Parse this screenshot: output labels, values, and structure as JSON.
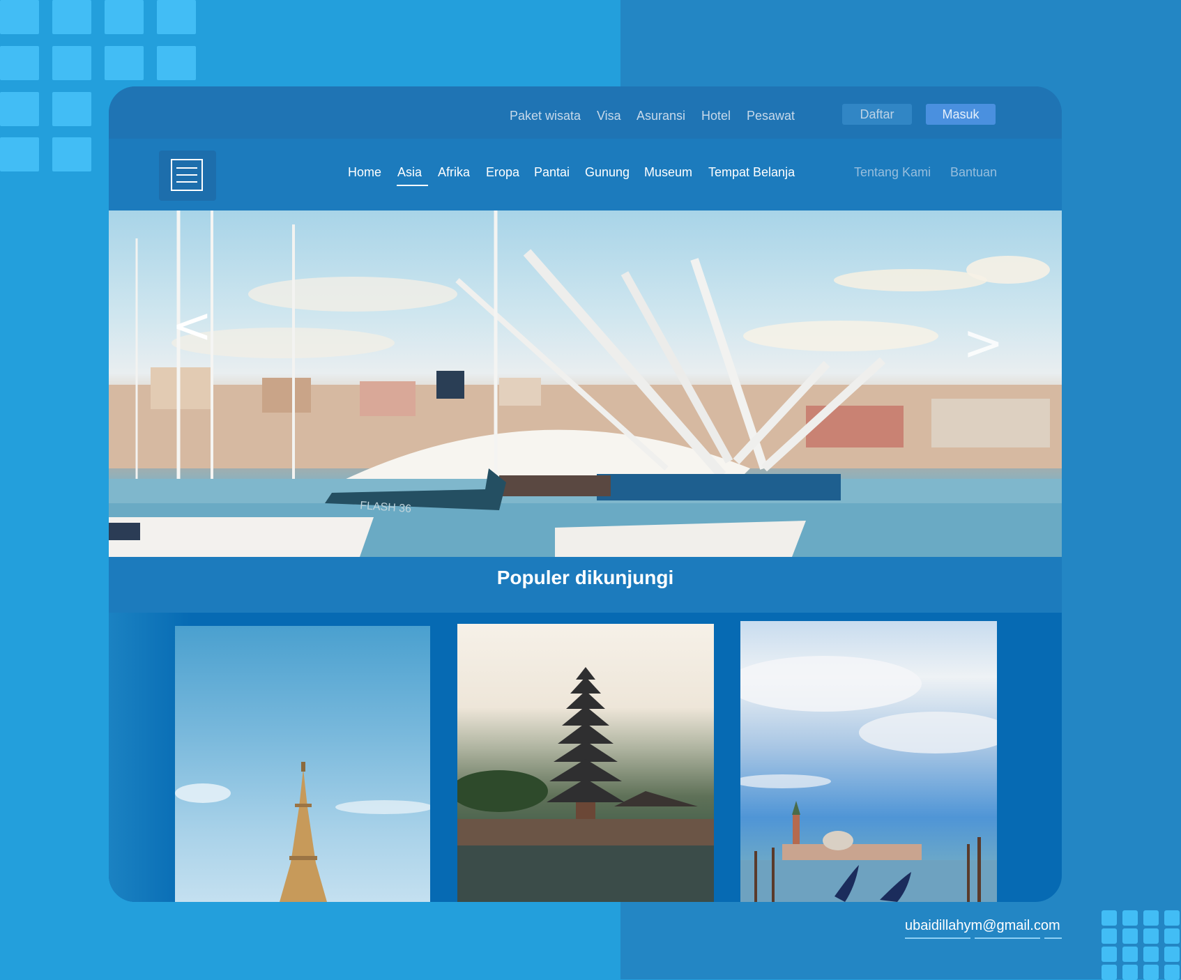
{
  "top_nav": {
    "links": [
      "Paket wisata",
      "Visa",
      "Asuransi",
      "Hotel",
      "Pesawat"
    ],
    "register_label": "Daftar",
    "login_label": "Masuk"
  },
  "main_nav": {
    "categories": [
      "Home",
      "Asia",
      "Afrika",
      "Eropa",
      "Pantai",
      "Gunung",
      "Museum",
      "Tempat Belanja"
    ],
    "active": "Asia",
    "secondary": [
      "Tentang Kami",
      "Bantuan"
    ]
  },
  "hero": {
    "prev_label": "<",
    "next_label": ">",
    "boat_text": "FLASH 36"
  },
  "section": {
    "title": "Populer dikunjungi"
  },
  "footer": {
    "email": "ubaidillahym@gmail.com"
  },
  "colors": {
    "background": "#239fdc",
    "card": "#1c7bbd",
    "accent_button": "#4a90df",
    "decor_squares": "#42bdf5"
  }
}
